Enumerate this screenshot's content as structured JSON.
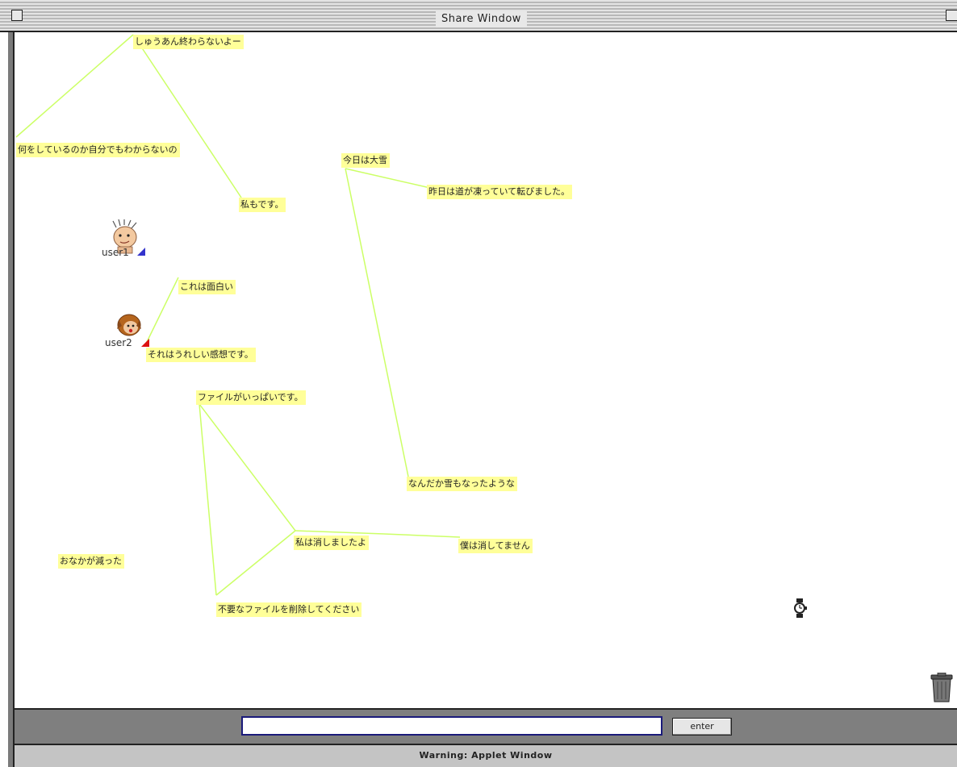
{
  "window": {
    "title": "Share Window"
  },
  "notes": [
    {
      "id": "n1",
      "text": "しゅうあん終わらないよー"
    },
    {
      "id": "n2",
      "text": "何をしているのか自分でもわからないの"
    },
    {
      "id": "n3",
      "text": "私もです。"
    },
    {
      "id": "n4",
      "text": "今日は大雪"
    },
    {
      "id": "n5",
      "text": "昨日は道が凍っていて転びました。"
    },
    {
      "id": "n6",
      "text": "これは面白い"
    },
    {
      "id": "n7",
      "text": "それはうれしい感想です。"
    },
    {
      "id": "n8",
      "text": "ファイルがいっぱいです。"
    },
    {
      "id": "n9",
      "text": "なんだか雪もなったような"
    },
    {
      "id": "n10",
      "text": "私は消しましたよ"
    },
    {
      "id": "n11",
      "text": "僕は消してません"
    },
    {
      "id": "n12",
      "text": "おなかが減った"
    },
    {
      "id": "n13",
      "text": "不要なファイルを削除してください"
    }
  ],
  "users": [
    {
      "name": "user1",
      "marker_color": "#3333cc"
    },
    {
      "name": "user2",
      "marker_color": "#dd1111"
    }
  ],
  "icons": {
    "watch": "watch-icon",
    "trash": "trash-icon"
  },
  "input": {
    "value": "",
    "button_label": "enter"
  },
  "status": {
    "text": "Warning: Applet Window"
  },
  "colors": {
    "note_bg": "#ffff99",
    "link_line": "#ccff66",
    "chrome_gray": "#7f7f7f"
  }
}
